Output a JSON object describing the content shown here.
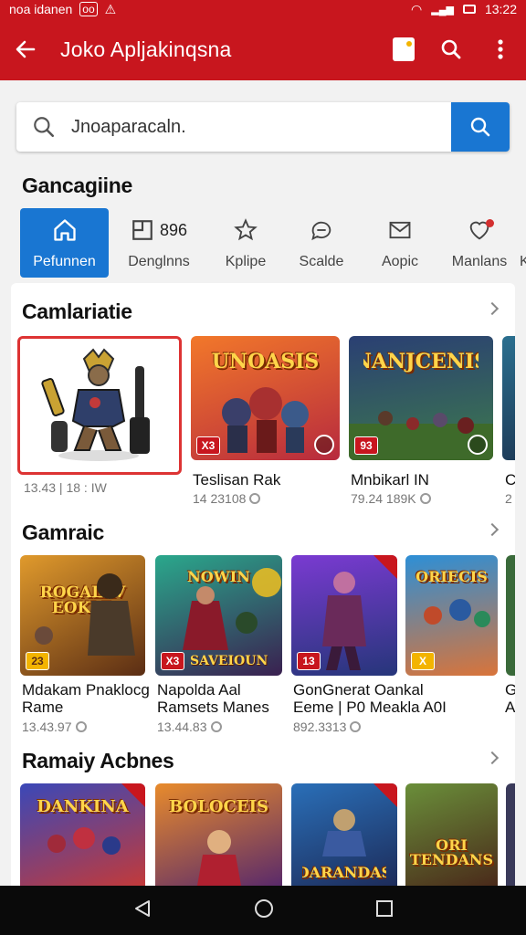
{
  "status_bar": {
    "left_text": "noa idanen",
    "time": "13:22"
  },
  "app_bar": {
    "title": "Joko Apljakinqsna"
  },
  "search": {
    "value": "Jnoaparacaln."
  },
  "categories": {
    "title": "Gancagiine",
    "chips": [
      {
        "label": "Pefunnen",
        "icon": "home-icon",
        "active": true
      },
      {
        "label": "Denglnns",
        "icon": "grid-icon",
        "count": "896"
      },
      {
        "label": "Kplipe",
        "icon": "star-icon"
      },
      {
        "label": "Scalde",
        "icon": "chat-icon"
      },
      {
        "label": "Aopic",
        "icon": "mail-icon"
      },
      {
        "label": "Manlans",
        "icon": "heart-icon"
      },
      {
        "label": "Ki",
        "icon": ""
      }
    ]
  },
  "sections": [
    {
      "title": "Camlariatie",
      "items": [
        {
          "banner": "",
          "name": "",
          "meta": "13.43 | 18 : IW",
          "colors": [
            "#ffffff",
            "#ffffff"
          ],
          "badge": ""
        },
        {
          "banner": "UNOASIS",
          "name": "Teslisan Rak",
          "meta": "14 23108",
          "colors": [
            "#f2782a",
            "#b72a3e"
          ],
          "badge": "X3"
        },
        {
          "banner": "NANJCENIS",
          "name": "Mnbikarl IN",
          "meta": "79.24 189K",
          "colors": [
            "#3d7a4d",
            "#2a3f73"
          ],
          "badge": "93"
        },
        {
          "banner": "",
          "name": "C",
          "meta": "2",
          "colors": [
            "#2b6f8f",
            "#1e3d5a"
          ],
          "badge": ""
        }
      ]
    },
    {
      "title": "Gamraic",
      "items": [
        {
          "banner": "ROGALAV EOKLE",
          "name": "Mdakam Pnaklocg",
          "name2": "Rame",
          "meta": "13.43.97",
          "colors": [
            "#e09a2c",
            "#5a2d14"
          ],
          "badge": "23"
        },
        {
          "banner": "NOWIN",
          "name": "Napolda Aal",
          "name2": "Ramsets Manes",
          "meta": "13.44.83",
          "colors": [
            "#2aa88c",
            "#3a2050"
          ],
          "badge": "X3",
          "sub": "SAVEIOUN"
        },
        {
          "banner": "",
          "name": "GonGnerat Oankal",
          "name2": "Eeme  | P0 Meakla A0I",
          "meta": "892.3313",
          "colors": [
            "#7a3ad1",
            "#26367a"
          ],
          "badge": "13"
        },
        {
          "banner": "ORIECIS",
          "name": "G",
          "name2": "A",
          "meta": "",
          "colors": [
            "#2d8fd6",
            "#d9743a"
          ],
          "badge": "X"
        }
      ]
    },
    {
      "title": "Ramaiy Acbnes",
      "items": [
        {
          "banner": "DANKINA",
          "colors": [
            "#3a48b8",
            "#c23a3a"
          ]
        },
        {
          "banner": "BOLOCEIS",
          "colors": [
            "#e88b2c",
            "#5a2a6a"
          ]
        },
        {
          "banner": "DARANDAS",
          "colors": [
            "#2a6fb8",
            "#1d2c5a"
          ]
        },
        {
          "banner": "ORI TENDANS",
          "colors": [
            "#6a8f3a",
            "#4a2a1a"
          ]
        }
      ]
    }
  ]
}
